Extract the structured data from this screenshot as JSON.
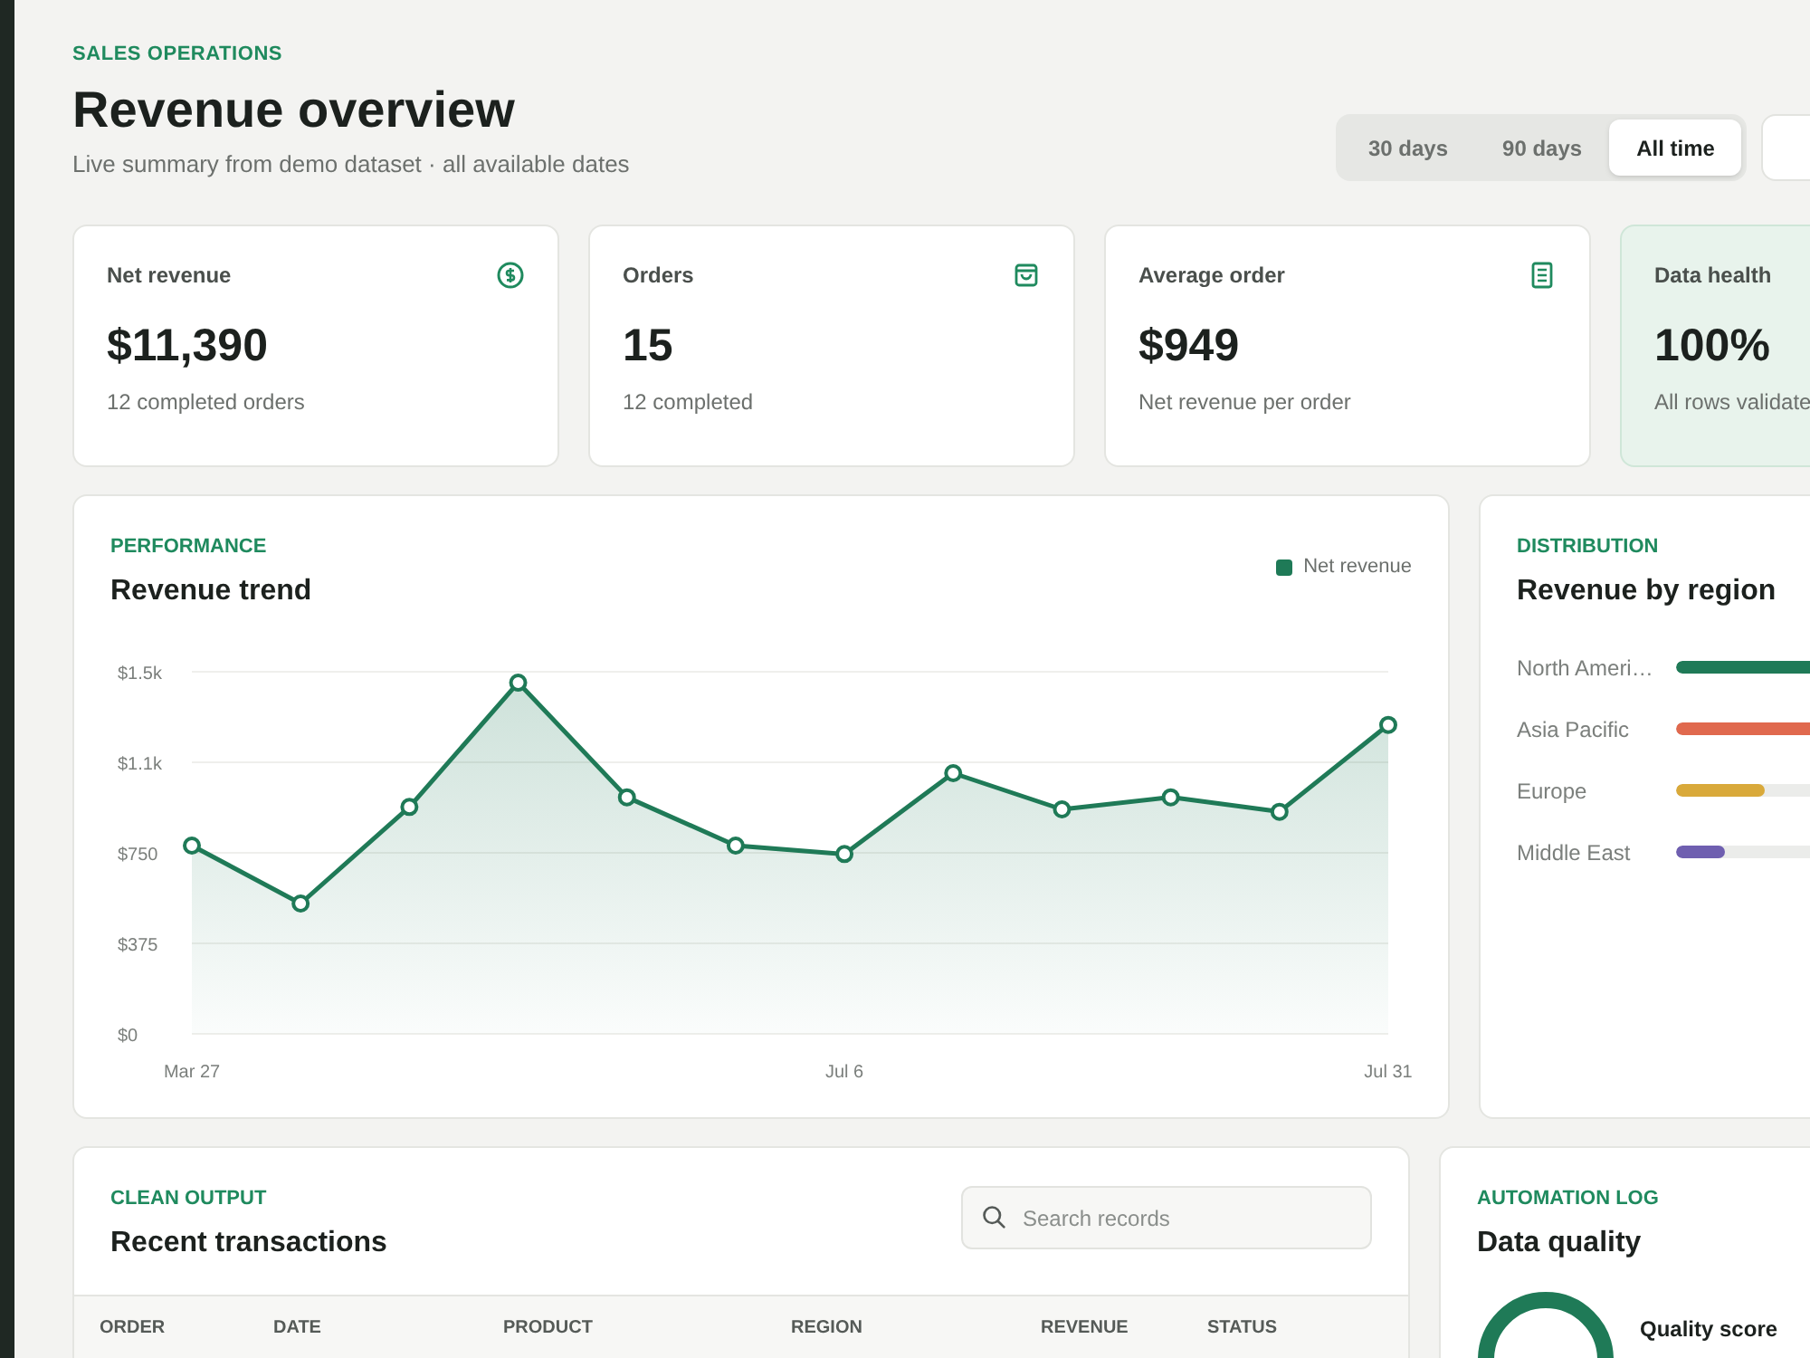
{
  "header": {
    "eyebrow": "SALES OPERATIONS",
    "title": "Revenue overview",
    "subtitle": "Live summary from demo dataset · all available dates"
  },
  "ranges": [
    {
      "label": "30 days",
      "selected": false
    },
    {
      "label": "90 days",
      "selected": false
    },
    {
      "label": "All time",
      "selected": true
    }
  ],
  "stats": [
    {
      "label": "Net revenue",
      "value": "$11,390",
      "note": "12 completed orders",
      "kind": "normal"
    },
    {
      "label": "Orders",
      "value": "15",
      "note": "12 completed",
      "kind": "normal"
    },
    {
      "label": "Average order",
      "value": "$949",
      "note": "Net revenue per order",
      "kind": "normal"
    },
    {
      "label": "Data health",
      "value": "100%",
      "note": "All rows validate",
      "kind": "health"
    }
  ],
  "performance": {
    "eyebrow": "PERFORMANCE",
    "title": "Revenue trend",
    "chart_data": {
      "type": "area",
      "grid": true,
      "categories": [
        "Mar 27",
        null,
        null,
        null,
        null,
        null,
        "Jul 6",
        null,
        null,
        null,
        null,
        "Jul 31"
      ],
      "ylim": [
        0,
        1500
      ],
      "yticks": [
        {
          "value": 0,
          "label": "$0"
        },
        {
          "value": 375,
          "label": "$375"
        },
        {
          "value": 750,
          "label": "$750"
        },
        {
          "value": 1125,
          "label": "$1.1k"
        },
        {
          "value": 1500,
          "label": "$1.5k"
        }
      ],
      "series": [
        {
          "name": "Net revenue",
          "color": "#1f7a57",
          "values": [
            780,
            540,
            940,
            1455,
            980,
            780,
            745,
            1080,
            930,
            980,
            920,
            1280
          ]
        }
      ]
    }
  },
  "distribution": {
    "eyebrow": "DISTRIBUTION",
    "title": "Revenue by region",
    "regions": [
      {
        "name": "North Ameri…",
        "level": 1.0,
        "color": "#1f7a57"
      },
      {
        "name": "Asia Pacific",
        "level": 0.8,
        "color": "#e0694e"
      },
      {
        "name": "Europe",
        "level": 0.36,
        "color": "#d9a93a"
      },
      {
        "name": "Middle East",
        "level": 0.2,
        "color": "#6f5fb0"
      }
    ]
  },
  "transactions": {
    "eyebrow": "CLEAN OUTPUT",
    "title": "Recent transactions",
    "search": {
      "placeholder": "Search records"
    },
    "columns": [
      "ORDER",
      "DATE",
      "PRODUCT",
      "REGION",
      "REVENUE",
      "STATUS"
    ]
  },
  "quality": {
    "eyebrow": "AUTOMATION LOG",
    "title": "Data quality",
    "score_label": "Quality score"
  }
}
